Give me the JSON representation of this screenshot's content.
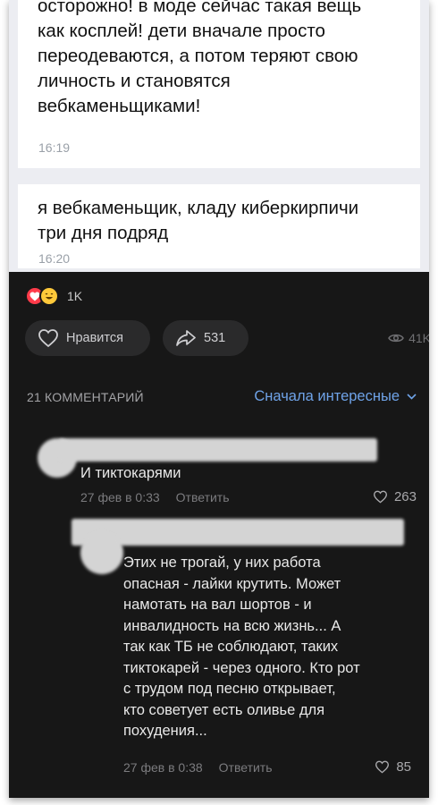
{
  "messages": [
    {
      "lines": [
        "осторожно! в моде сейчас такая вещь",
        "как косплей! дети вначале просто",
        "переодеваются, а потом теряют свою",
        "личность и становятся",
        "вебкаменьщиками!"
      ],
      "time": "16:19"
    },
    {
      "lines": [
        "я вебкаменьщик, кладу киберкирпичи",
        "три дня подряд"
      ],
      "time": "16:20"
    }
  ],
  "reactions": {
    "count": "1K",
    "icons": [
      "heart-reaction",
      "laugh-reaction"
    ]
  },
  "actions": {
    "like_label": "Нравится",
    "share_count": "531",
    "views_count": "41K"
  },
  "comments_header": {
    "title": "21 КОММЕНТАРИЙ",
    "sort_label": "Сначала интересные"
  },
  "comments": [
    {
      "lines": [
        "И тиктокарями"
      ],
      "date": "27 фев в 0:33",
      "reply_label": "Ответить",
      "likes": "263"
    },
    {
      "lines": [
        "Этих не трогай, у них работа",
        "опасная - лайки крутить. Может",
        "намотать на вал шортов - и",
        "инвалидность на всю жизнь... А",
        "так как ТБ не соблюдают, таких",
        "тиктокарей - через одного. Кто рот",
        "с трудом под песню открывает,",
        "кто советует есть оливье для",
        "похудения..."
      ],
      "date": "27 фев в 0:38",
      "reply_label": "Ответить",
      "likes": "85"
    }
  ],
  "colors": {
    "accent": "#6fa3e8",
    "dark_bg": "#171717",
    "chat_bg": "#ecedf2",
    "heart": "#ff3b4a"
  }
}
